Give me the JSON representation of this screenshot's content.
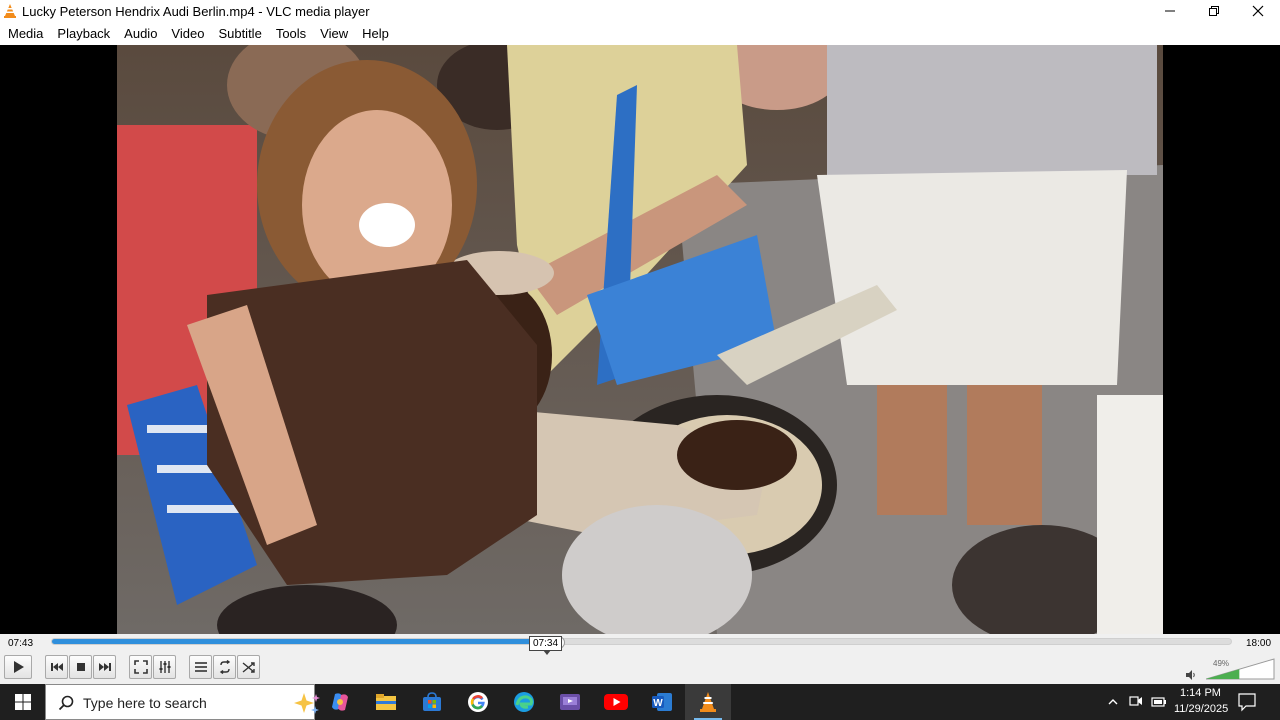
{
  "window": {
    "title": "Lucky Peterson Hendrix Audi Berlin.mp4 - VLC media player",
    "icon": "vlc-cone-icon"
  },
  "menu": [
    "Media",
    "Playback",
    "Audio",
    "Video",
    "Subtitle",
    "Tools",
    "View",
    "Help"
  ],
  "player": {
    "elapsed": "07:43",
    "total": "18:00",
    "hover_time": "07:34",
    "position_fraction": 0.429,
    "volume_label": "49%",
    "volume_fraction": 0.49
  },
  "controls": {
    "buttons": [
      "play-icon",
      "previous-icon",
      "stop-icon",
      "next-icon",
      "fullscreen-icon",
      "extended-settings-icon",
      "playlist-icon",
      "loop-icon",
      "shuffle-icon"
    ]
  },
  "taskbar": {
    "search_placeholder": "Type here to search",
    "apps": [
      "copilot-icon",
      "file-explorer-icon",
      "microsoft-store-icon",
      "chrome-icon",
      "edge-icon",
      "media-app-icon",
      "youtube-icon",
      "word-icon",
      "vlc-taskbar-icon"
    ],
    "time": "1:14 PM",
    "date": "11/29/2025"
  },
  "colors": {
    "seek_fill": "#2f8fdc",
    "volume_fill": "#4caf50",
    "taskbar_bg": "#1f1f1f",
    "vlc_orange": "#f28c1b"
  }
}
